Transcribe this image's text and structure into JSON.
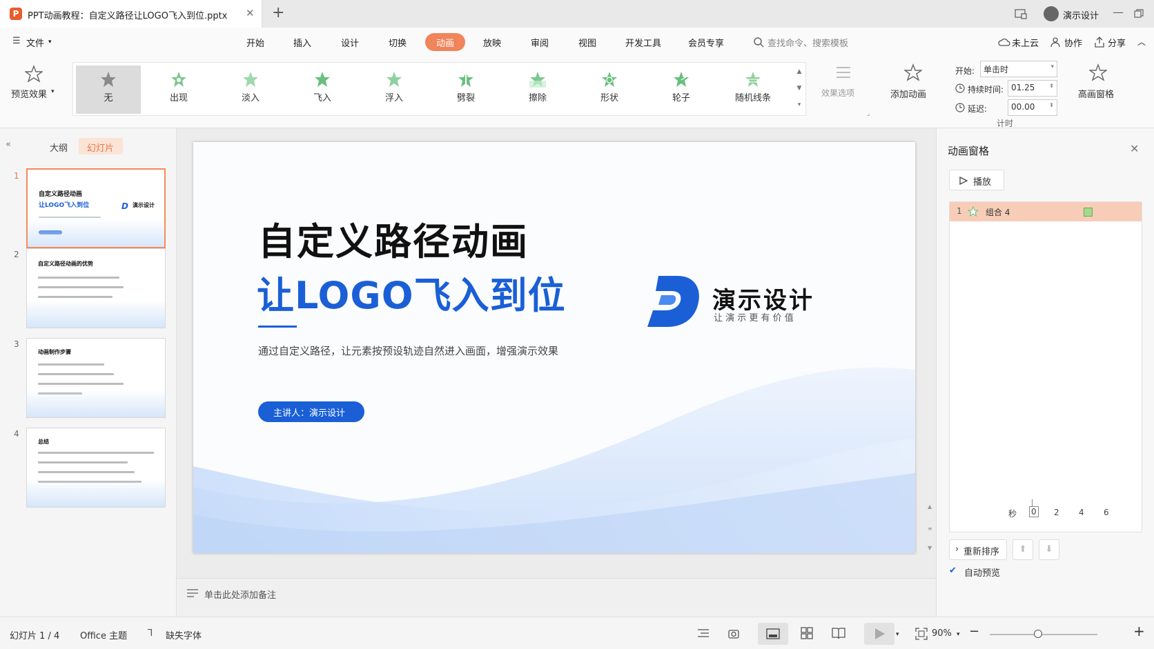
{
  "titlebar": {
    "doc_title": "PPT动画教程：自定义路径让LOGO飞入到位.pptx",
    "user_name": "演示设计"
  },
  "menu": {
    "file": "文件",
    "tabs": [
      "开始",
      "插入",
      "设计",
      "切换",
      "动画",
      "放映",
      "审阅",
      "视图",
      "开发工具",
      "会员专享"
    ],
    "active_tab": "动画",
    "search_placeholder": "查找命令、搜索模板",
    "cloud": "未上云",
    "collab": "协作",
    "share": "分享"
  },
  "ribbon": {
    "preview": "预览效果",
    "effects": [
      "无",
      "出现",
      "淡入",
      "飞入",
      "浮入",
      "劈裂",
      "擦除",
      "形状",
      "轮子",
      "随机线条"
    ],
    "selected_effect": "无",
    "effect_options": "效果选项",
    "add_animation": "添加动画",
    "start_label": "开始:",
    "start_value": "单击时",
    "duration_label": "持续时间:",
    "duration_value": "01.25",
    "delay_label": "延迟:",
    "delay_value": "00.00",
    "timing_group": "计时",
    "anim_pane": "高画窗格"
  },
  "leftpane": {
    "outline_tab": "大纲",
    "slides_tab": "幻灯片",
    "thumbs": [
      {
        "num": "1",
        "title": "自定义路径动画",
        "sub": "让LOGO飞入到位",
        "brand": "演示设计"
      },
      {
        "num": "2",
        "title": "自定义路径动画的优势"
      },
      {
        "num": "3",
        "title": "动画制作步骤"
      },
      {
        "num": "4",
        "title": "总结"
      }
    ]
  },
  "slide": {
    "title": "自定义路径动画",
    "subtitle": "让LOGO飞入到位",
    "description": "通过自定义路径，让元素按预设轨迹自然进入画面，增强演示效果",
    "presenter": "主讲人：演示设计",
    "brand_name": "演示设计",
    "brand_tagline": "让 演 示 更 有 价 值"
  },
  "notes": {
    "placeholder": "单击此处添加备注"
  },
  "animpane": {
    "title": "动画窗格",
    "play": "播放",
    "item_index": "1",
    "item_name": "组合 4",
    "timeline_label": "秒",
    "timeline_ticks": [
      "0",
      "2",
      "4",
      "6"
    ],
    "reorder": "重新排序",
    "auto_preview": "自动预览"
  },
  "status": {
    "slide_info": "幻灯片 1 / 4",
    "theme": "Office 主题",
    "missing_font": "缺失字体",
    "zoom": "90%",
    "zoom_fraction": 0.45
  },
  "colors": {
    "accent": "#f0845a",
    "brand_blue": "#1a5fd6",
    "selected_row": "#f7cdb8"
  }
}
